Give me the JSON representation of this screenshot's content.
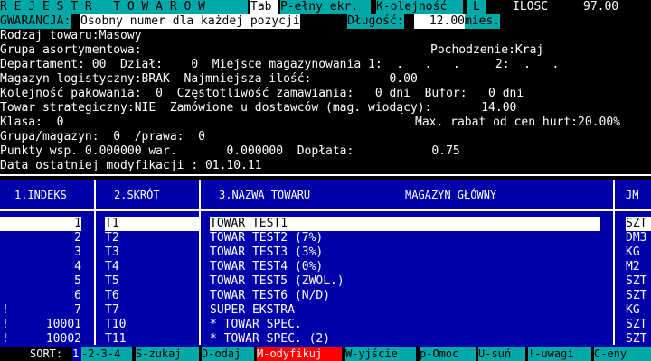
{
  "topbar": {
    "title": "R E J E S T R   T O W A R Ó W",
    "tab_key": "Tab",
    "full_screen": "P-ełny ekr.",
    "order": "K-olejność",
    "l_key": "L",
    "qty_label": "ILOŚĆ",
    "qty_value": "97.00"
  },
  "fields": {
    "gwarancja_label": "GWARANCJA:",
    "gwarancja_value": "Osobny numer dla każdej pozycji",
    "dlugosc_label": "Długość:",
    "dlugosc_value": "12.00",
    "dlugosc_unit": "mies.",
    "rodzaj": "Rodzaj towaru:Masowy",
    "grupa_asort": "Grupa asortymentowa:",
    "pochodzenie": "Pochodzenie:Kraj",
    "departament": "Departament: 00  Dział:    0  Miejsce magazynowania 1:  .   .   .     2:  .   .",
    "magazyn_log": "Magazyn logistyczny:BRAK  Najmniejsza ilość:           0.00",
    "kolejnosc": "Kolejność pakowania:  0  Częstotliwość zamawiania:   0 dni  Bufor:   0 dni",
    "towar_strat": "Towar strategiczny:NIE  Zamówione u dostawców (mag. wiodący):       14.00",
    "klasa": "Klasa:  0",
    "max_rabat": "Max. rabat od cen hurt:20.00%",
    "grupa_mag": "Grupa/magazyn:  0  /prawa:  0",
    "punkty": "Punkty wsp. 0.000000 war.       0.000000  Dopłata:           0.75",
    "data_mod": "Data ostatniej modyfikacji : 01.10.11"
  },
  "columns": {
    "indeks": "1.INDEKS",
    "skrot": "2.SKRÓT",
    "nazwa": "3.NAZWA TOWARU",
    "magazyn": "MAGAZYN GŁÓWNY",
    "jm": "JM"
  },
  "rows": [
    {
      "flag": "",
      "indeks": "1",
      "skrot": "T1",
      "nazwa": "TOWAR TEST1",
      "jm": "SZT"
    },
    {
      "flag": "",
      "indeks": "2",
      "skrot": "T2",
      "nazwa": "TOWAR TEST2 (7%)",
      "jm": "DM3"
    },
    {
      "flag": "",
      "indeks": "3",
      "skrot": "T3",
      "nazwa": "TOWAR TEST3 (3%)",
      "jm": "KG"
    },
    {
      "flag": "",
      "indeks": "4",
      "skrot": "T4",
      "nazwa": "TOWAR TEST4 (0%)",
      "jm": "M2"
    },
    {
      "flag": "",
      "indeks": "5",
      "skrot": "T5",
      "nazwa": "TOWAR TEST5 (ZWOL.)",
      "jm": "SZT"
    },
    {
      "flag": "",
      "indeks": "6",
      "skrot": "T6",
      "nazwa": "TOWAR TEST6 (N/D)",
      "jm": "SZT"
    },
    {
      "flag": "!",
      "indeks": "7",
      "skrot": "T7",
      "nazwa": "SUPER EKSTRA",
      "jm": "KG"
    },
    {
      "flag": "!",
      "indeks": "10001",
      "skrot": "T10",
      "nazwa": "* TOWAR SPEC.",
      "jm": "SZT"
    },
    {
      "flag": "!",
      "indeks": "10002",
      "skrot": "T11",
      "nazwa": "* TOWAR SPEC. (2)",
      "jm": "SZT"
    }
  ],
  "footer": {
    "sort": "SORT:",
    "sort_1": "1",
    "sort_rest": "-2-3-4",
    "szukaj": "S-zukaj",
    "dodaj": "D-odaj",
    "modyfikuj": "M-odyfikuj",
    "wyjscie": "W-yjście",
    "pomoc": "p-Omoc",
    "usun": "U-suń",
    "uwagi": "!-uwagi",
    "ceny": "C-eny"
  },
  "colors": {
    "cyan": "#00a8a8",
    "blue": "#0000a8",
    "red": "#ff0000"
  }
}
